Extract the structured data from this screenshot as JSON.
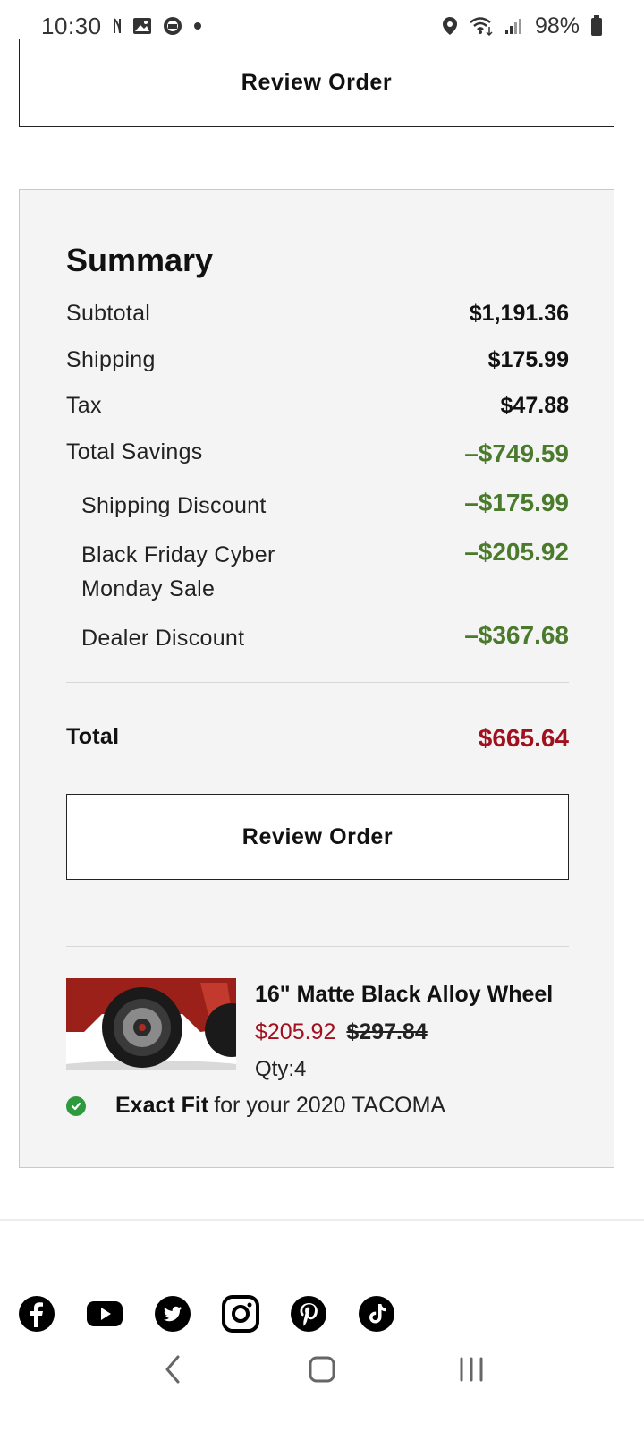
{
  "status_bar": {
    "time": "10:30",
    "battery": "98%",
    "icons": [
      "nfc-icon",
      "gallery-icon",
      "app-icon",
      "dot-icon",
      "location-icon",
      "wifi-icon",
      "signal-icon",
      "battery-icon"
    ]
  },
  "top_button": {
    "label": "Review Order"
  },
  "summary": {
    "title": "Summary",
    "rows": [
      {
        "label": "Subtotal",
        "value": "$1,191.36"
      },
      {
        "label": "Shipping",
        "value": "$175.99"
      },
      {
        "label": "Tax",
        "value": "$47.88"
      },
      {
        "label": "Total Savings",
        "value": "–$749.59"
      }
    ],
    "savings": [
      {
        "label": "Shipping Discount",
        "value": "–$175.99"
      },
      {
        "label": "Black Friday Cyber Monday Sale",
        "value": "–$205.92"
      },
      {
        "label": "Dealer Discount",
        "value": "–$367.68"
      }
    ],
    "total_label": "Total",
    "total_value": "$665.64",
    "review_button": "Review Order"
  },
  "product": {
    "name": "16\" Matte Black Alloy Wheel",
    "sale_price": "$205.92",
    "original_price": "$297.84",
    "qty": "Qty:4",
    "fit_strong": "Exact Fit",
    "fit_text": "for your 2020 TACOMA"
  },
  "social": [
    "facebook-icon",
    "youtube-icon",
    "twitter-icon",
    "instagram-icon",
    "pinterest-icon",
    "tiktok-icon"
  ],
  "colors": {
    "savings_green": "#4a7a2c",
    "total_red": "#a0101e",
    "card_bg": "#f4f4f4",
    "check_green": "#2e9a3e"
  }
}
